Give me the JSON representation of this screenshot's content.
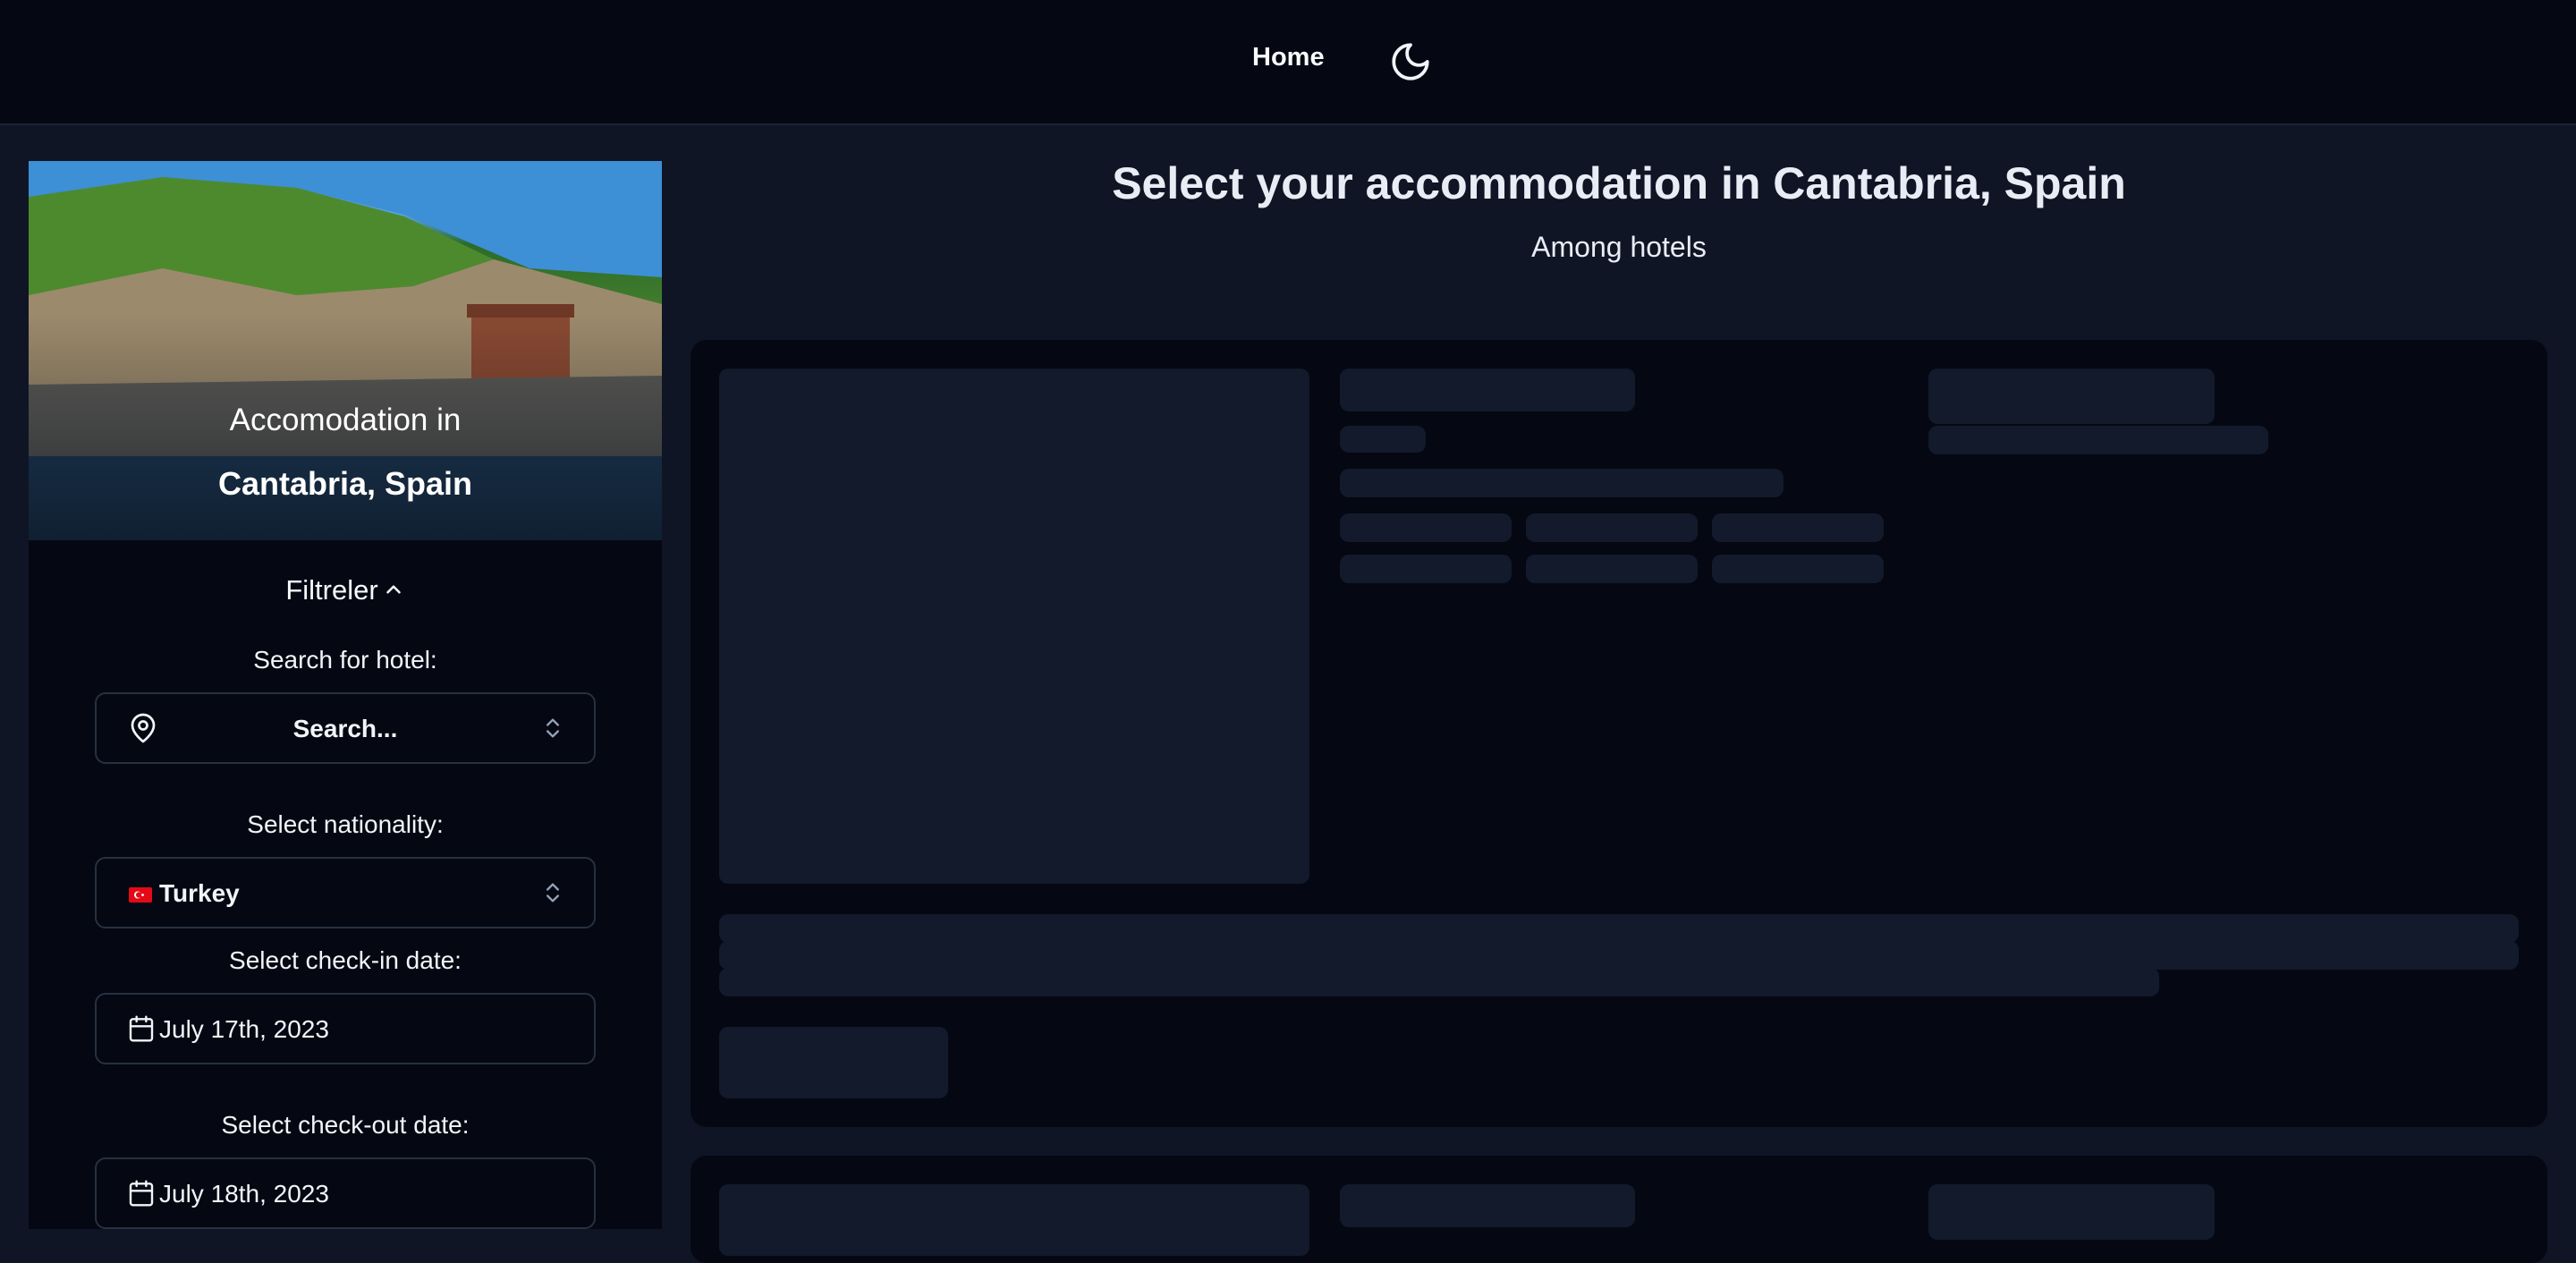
{
  "nav": {
    "home_label": "Home",
    "theme_icon": "moon-icon"
  },
  "sidebar": {
    "hero": {
      "line1": "Accomodation in",
      "line2": "Cantabria, Spain"
    },
    "filters_label": "Filtreler",
    "hotel_search": {
      "label": "Search for hotel:",
      "value": "Search..."
    },
    "nationality": {
      "label": "Select nationality:",
      "value": "Turkey"
    },
    "checkin": {
      "label": "Select check-in date:",
      "value": "July 17th, 2023"
    },
    "checkout": {
      "label": "Select check-out date:",
      "value": "July 18th, 2023"
    }
  },
  "main": {
    "title": "Select your accommodation in Cantabria, Spain",
    "subtitle": "Among hotels"
  },
  "colors": {
    "page_bg": "#0f1524",
    "panel_bg": "#050812",
    "skeleton": "#121a2b",
    "flag_red": "#e30a17"
  }
}
